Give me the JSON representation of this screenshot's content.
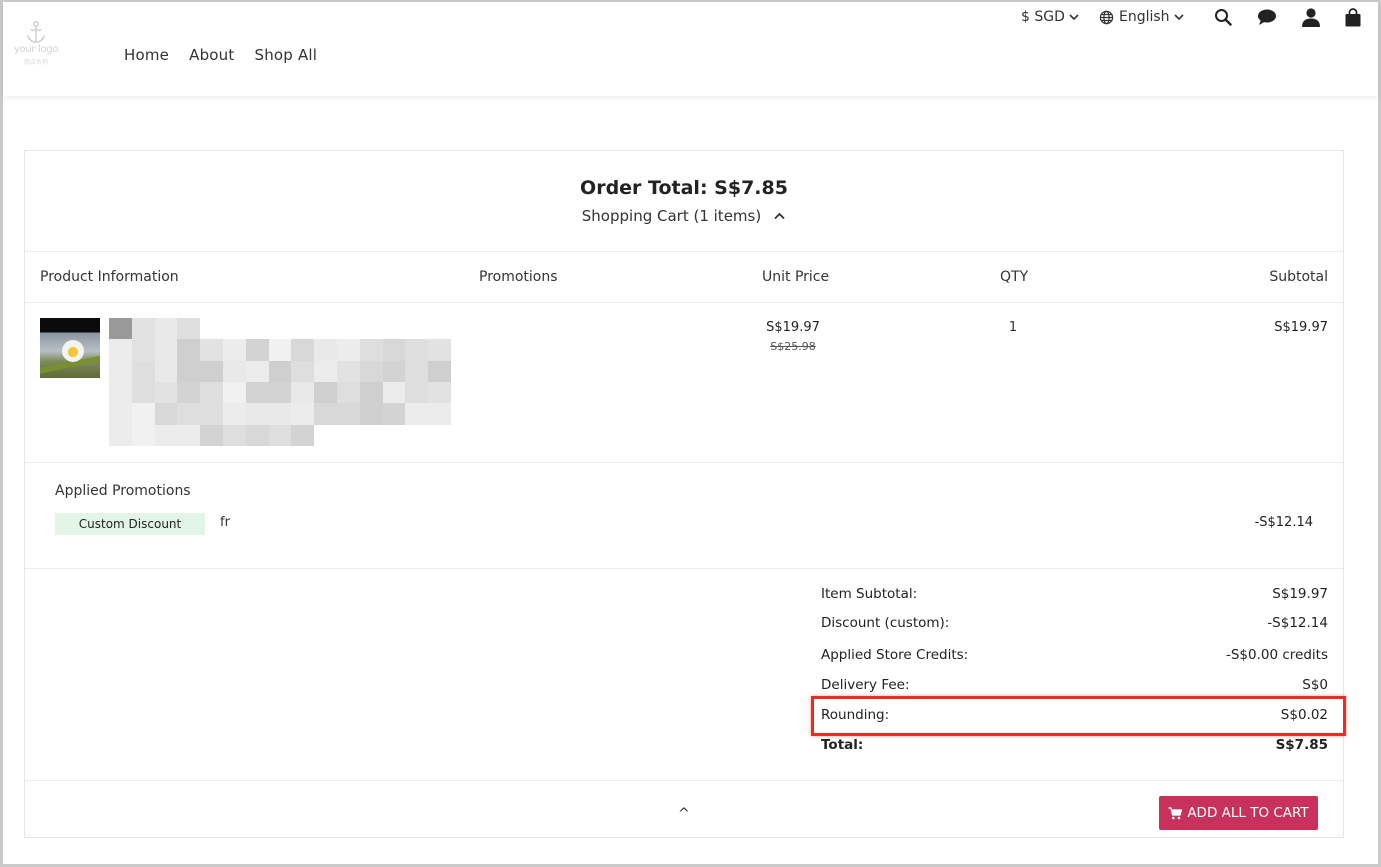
{
  "header": {
    "logo_text": "your logo",
    "logo_sub": "商店名称",
    "nav": [
      "Home",
      "About",
      "Shop All"
    ],
    "currency": "$ SGD",
    "language": "English"
  },
  "cart": {
    "order_total_label": "Order Total: S$7.85",
    "cart_toggle_label": "Shopping Cart (1 items)",
    "columns": {
      "product": "Product Information",
      "promotions": "Promotions",
      "unit_price": "Unit Price",
      "qty": "QTY",
      "subtotal": "Subtotal"
    },
    "item": {
      "unit_price": "S$19.97",
      "original_price": "S$25.98",
      "qty": "1",
      "subtotal": "S$19.97"
    },
    "applied_promotions": {
      "title": "Applied Promotions",
      "badge": "Custom Discount",
      "name": "fr",
      "amount": "-S$12.14"
    },
    "summary": [
      {
        "label": "Item Subtotal:",
        "value": "S$19.97"
      },
      {
        "label": "Discount (custom):",
        "value": "-S$12.14"
      },
      {
        "label": "Applied Store Credits:",
        "value": "-S$0.00 credits"
      },
      {
        "label": "Delivery Fee:",
        "value": "S$0"
      },
      {
        "label": "Rounding:",
        "value": "S$0.02"
      },
      {
        "label": "Total:",
        "value": "S$7.85"
      }
    ],
    "collapse_label": "^",
    "add_all_button": "ADD ALL TO CART"
  },
  "colors": {
    "accent": "#c8325a",
    "highlight": "#ee2a24",
    "badge_bg": "#e3f5e6"
  },
  "icons": [
    "anchor-icon",
    "chevron-down-icon",
    "globe-icon",
    "search-icon",
    "chat-icon",
    "user-icon",
    "shopping-bag-icon",
    "chevron-up-icon",
    "cart-icon"
  ]
}
